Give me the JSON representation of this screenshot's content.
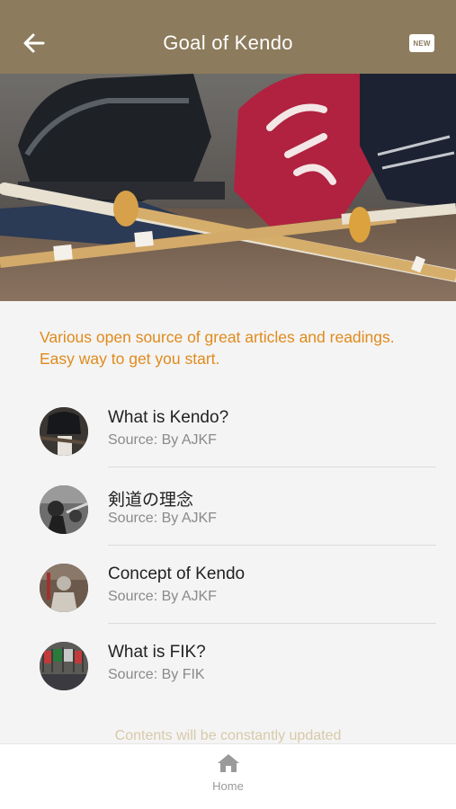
{
  "header": {
    "title": "Goal of Kendo",
    "new_badge": "NEW",
    "back_icon": "arrow-left-icon"
  },
  "intro": "Various open source of great articles and readings. Easy way to get you start.",
  "articles": [
    {
      "title": "What is Kendo?",
      "source": "Source: By AJKF"
    },
    {
      "title": "剣道の理念",
      "source": "Source: By AJKF"
    },
    {
      "title": "Concept of Kendo",
      "source": "Source: By AJKF"
    },
    {
      "title": "What is FIK?",
      "source": "Source: By FIK"
    }
  ],
  "footer_note": "Contents will be constantly updated",
  "tabbar": {
    "home_label": "Home",
    "home_icon": "home-icon"
  },
  "colors": {
    "header": "#8c7b5c",
    "accent": "#e08a1c",
    "footer_note": "#d8c9a9"
  }
}
